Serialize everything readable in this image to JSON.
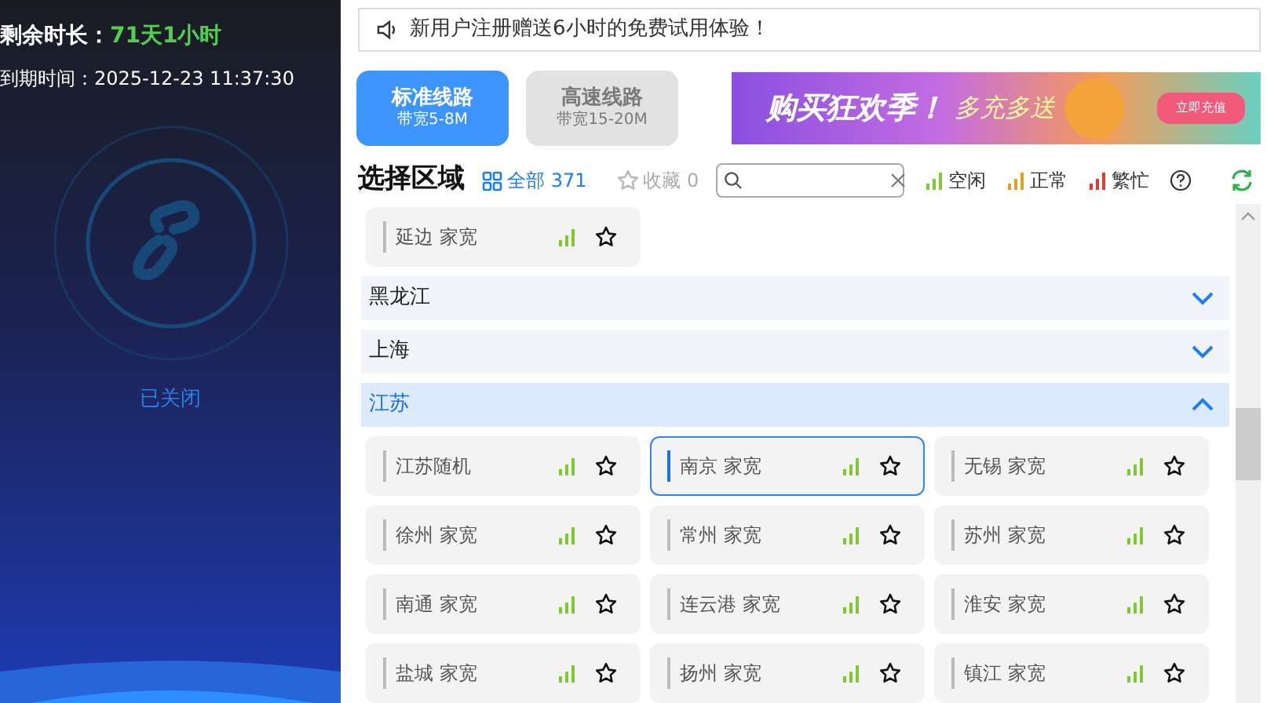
{
  "account": {
    "remaining_label": "剩余时长：",
    "remaining_value": "71天1小时",
    "expiry": "到期时间：2025-12-23 11:37:30",
    "connection_status": "已关闭",
    "connected": false
  },
  "notice": {
    "text": "新用户注册赠送6小时的免费试用体验！"
  },
  "lines": [
    {
      "title": "标准线路",
      "subtitle": "带宽5-8M",
      "selected": true
    },
    {
      "title": "高速线路",
      "subtitle": "带宽15-20M",
      "selected": false
    }
  ],
  "banner": {
    "headline": "购买狂欢季！",
    "tagline": "多充多送",
    "button": "立即充值"
  },
  "region": {
    "title": "选择区域",
    "all_label": "全部",
    "all_count": "371",
    "all_selected": true,
    "favorites_label": "收藏",
    "favorites_count": "0",
    "favorites_selected": false,
    "legend": [
      {
        "label": "空闲",
        "color": "#7ec92f"
      },
      {
        "label": "正常",
        "color": "#e0a020"
      },
      {
        "label": "繁忙",
        "color": "#e53935"
      }
    ]
  },
  "top_items": [
    {
      "name": "延边 家宽",
      "color": "#7ec92f",
      "selected": false
    }
  ],
  "groups": [
    {
      "name": "黑龙江",
      "expanded": false
    },
    {
      "name": "上海",
      "expanded": false
    },
    {
      "name": "江苏",
      "expanded": true,
      "items": [
        {
          "name": "江苏随机",
          "color": "#7ec92f",
          "selected": false
        },
        {
          "name": "南京 家宽",
          "color": "#7ec92f",
          "selected": true
        },
        {
          "name": "无锡 家宽",
          "color": "#7ec92f",
          "selected": false
        },
        {
          "name": "徐州 家宽",
          "color": "#7ec92f",
          "selected": false
        },
        {
          "name": "常州 家宽",
          "color": "#7ec92f",
          "selected": false
        },
        {
          "name": "苏州 家宽",
          "color": "#7ec92f",
          "selected": false
        },
        {
          "name": "南通 家宽",
          "color": "#7ec92f",
          "selected": false
        },
        {
          "name": "连云港 家宽",
          "color": "#7ec92f",
          "selected": false
        },
        {
          "name": "淮安 家宽",
          "color": "#7ec92f",
          "selected": false
        },
        {
          "name": "盐城 家宽",
          "color": "#7ec92f",
          "selected": false
        },
        {
          "name": "扬州 家宽",
          "color": "#7ec92f",
          "selected": false
        },
        {
          "name": "镇江 家宽",
          "color": "#7ec92f",
          "selected": false
        }
      ]
    }
  ]
}
